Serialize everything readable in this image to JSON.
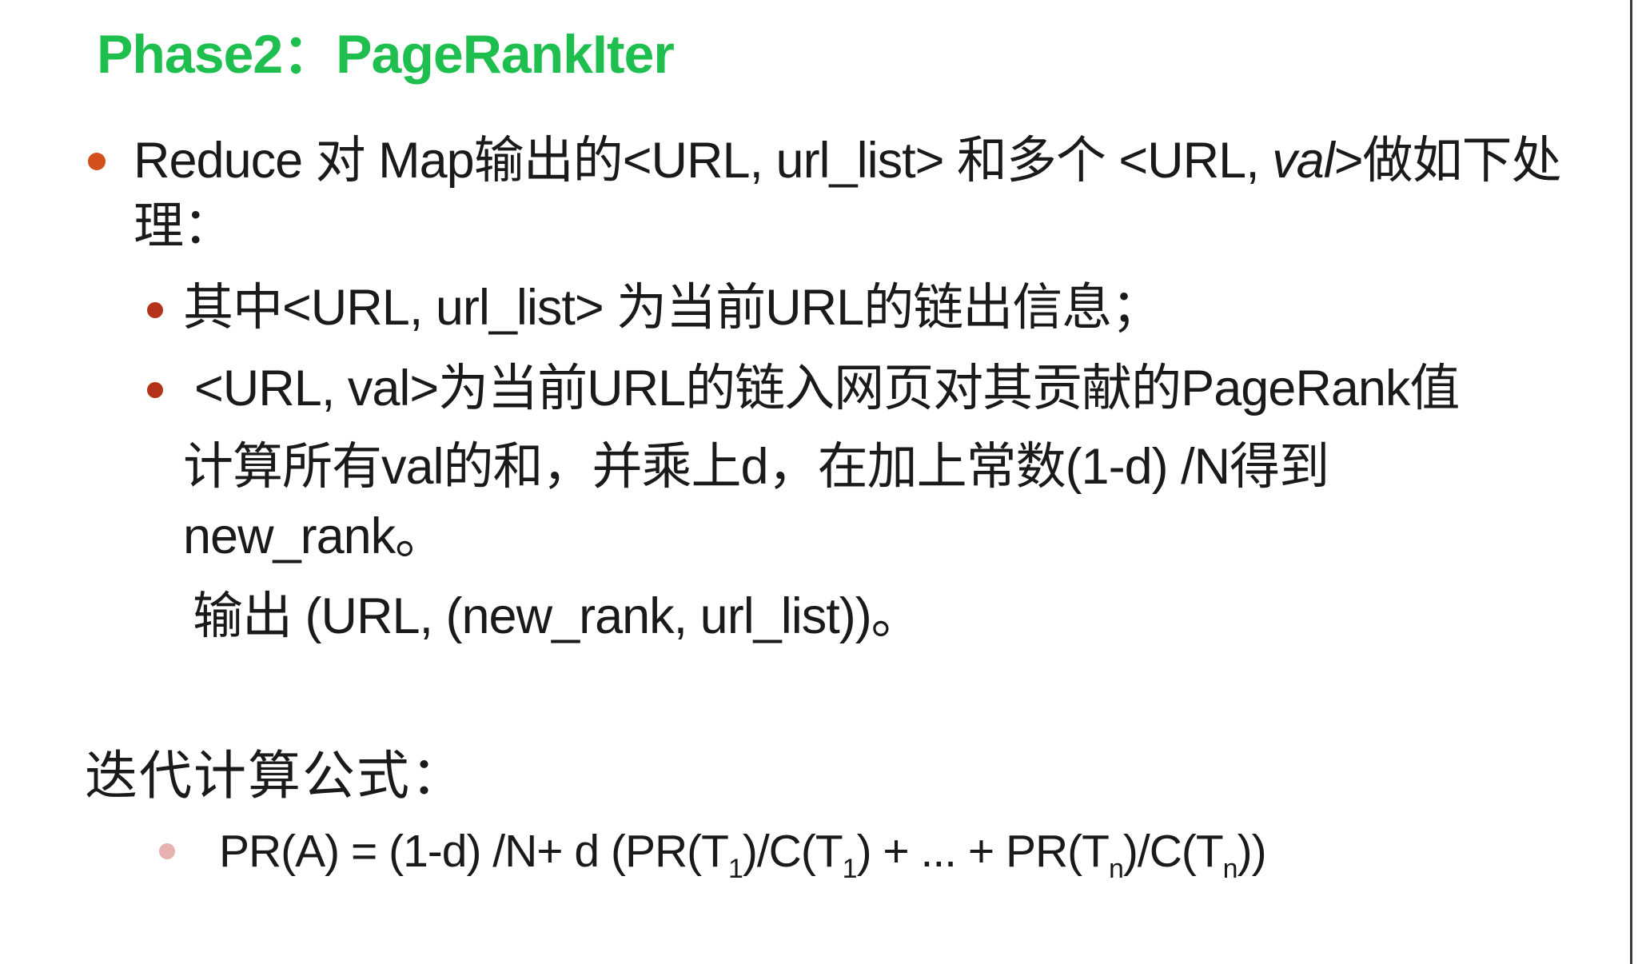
{
  "title": "Phase2：PageRankIter",
  "bullet1": {
    "line1_a": "Reduce 对 Map输出的<URL, url_list> 和多个 <URL, ",
    "line1_italic": "val",
    "line1_b": ">做如下处",
    "line2": "理："
  },
  "sub_bullets": [
    "其中<URL, url_list> 为当前URL的链出信息；",
    "<URL, val>为当前URL的链入网页对其贡献的PageRank值"
  ],
  "paragraph": {
    "line1": "计算所有val的和，并乘上d，在加上常数(1-d) /N得到",
    "line2": "new_rank。",
    "line3": "输出 (URL, (new_rank, url_list))。"
  },
  "section_heading": "迭代计算公式：",
  "formula": {
    "p1": "PR(A) = (1-d) /N+ d (PR(T",
    "s1": "1",
    "p2": ")/C(T",
    "s2": "1",
    "p3": ") + ... + PR(T",
    "s3": "n",
    "p4": ")/C(T",
    "s4": "n",
    "p5": "))"
  },
  "colors": {
    "title": "#1fbf4f",
    "bullet_primary": "#d34f1c",
    "bullet_secondary": "#b3331b",
    "bullet_formula": "#e8b1b1",
    "text": "#1a1a1a"
  }
}
